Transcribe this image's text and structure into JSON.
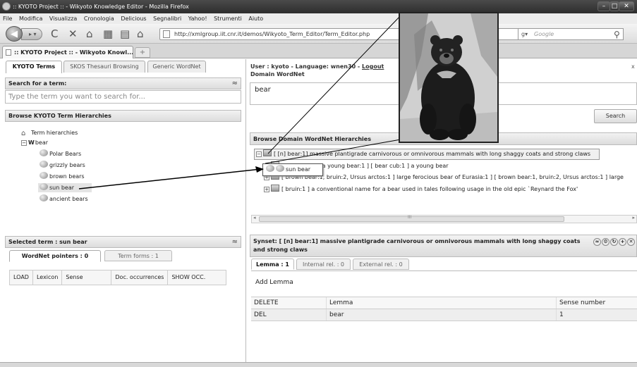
{
  "window": {
    "title": ":: KYOTO Project :: - Wikyoto Knowledge Editor - Mozilla Firefox"
  },
  "menu": [
    "File",
    "Modifica",
    "Visualizza",
    "Cronologia",
    "Delicious",
    "Segnalibri",
    "Yahoo!",
    "Strumenti",
    "Aiuto"
  ],
  "browser": {
    "url": "http://xmlgroup.iit.cnr.it/demos/Wikyoto_Term_Editor/Term_Editor.php",
    "search_placeholder": "Google",
    "tab_title": ":: KYOTO Project :: - Wikyoto Knowl...",
    "new_tab": "+"
  },
  "left_tabs": [
    "KYOTO Terms",
    "SKOS Thesauri Browsing",
    "Generic WordNet"
  ],
  "search": {
    "header": "Search for a term:",
    "placeholder": "Type the term you want to search for..."
  },
  "browse": {
    "header": "Browse KYOTO Term Hierarchies",
    "root": "Term hierarchies",
    "term": "bear",
    "children": [
      "Polar Bears",
      "grizzly bears",
      "brown bears",
      "sun bear",
      "ancient bears"
    ]
  },
  "selected": {
    "header": "Selected term : sun bear",
    "tab_pointers": "WordNet pointers : 0",
    "tab_forms": "Term forms : 1",
    "columns": [
      "LOAD",
      "Lexicon",
      "Sense",
      "Doc. occurrences",
      "SHOW OCC."
    ]
  },
  "user": {
    "line1": "User : kyoto - Language: wnen30 -",
    "logout": "Logout",
    "line2": "Domain WordNet"
  },
  "domain_term": "bear",
  "search_button": "Search",
  "dwh": {
    "header": "Browse Domain WordNet Hierarchies",
    "synsets": [
      "[ [n] bear:1]  massive plantigrade carnivorous or omnivorous mammals with long shaggy coats and strong claws",
      "[ a young bear:1 ]  [ bear cub:1 ] a young bear",
      "[ brown bear:1, bruin:2, Ursus arctos:1 ] large ferocious bear of Eurasia:1 ]  [ brown bear:1, bruin:2, Ursus arctos:1 ] large",
      "[ bruin:1 ]  a conventional name for a bear used in tales following usage in the old epic `Reynard the Fox'"
    ],
    "popup": "sun bear",
    "scroll_marker": "III"
  },
  "synset_panel": {
    "header": "Synset: [ [n] bear:1] massive plantigrade carnivorous or omnivorous mammals with long shaggy coats and strong claws",
    "tabs": [
      "Lemma : 1",
      "Internal rel. : 0",
      "External rel. : 0"
    ],
    "add_lemma": "Add Lemma",
    "columns": [
      "DELETE",
      "Lemma",
      "Sense number"
    ],
    "row": {
      "action": "DEL",
      "lemma": "bear",
      "sense": "1"
    }
  }
}
